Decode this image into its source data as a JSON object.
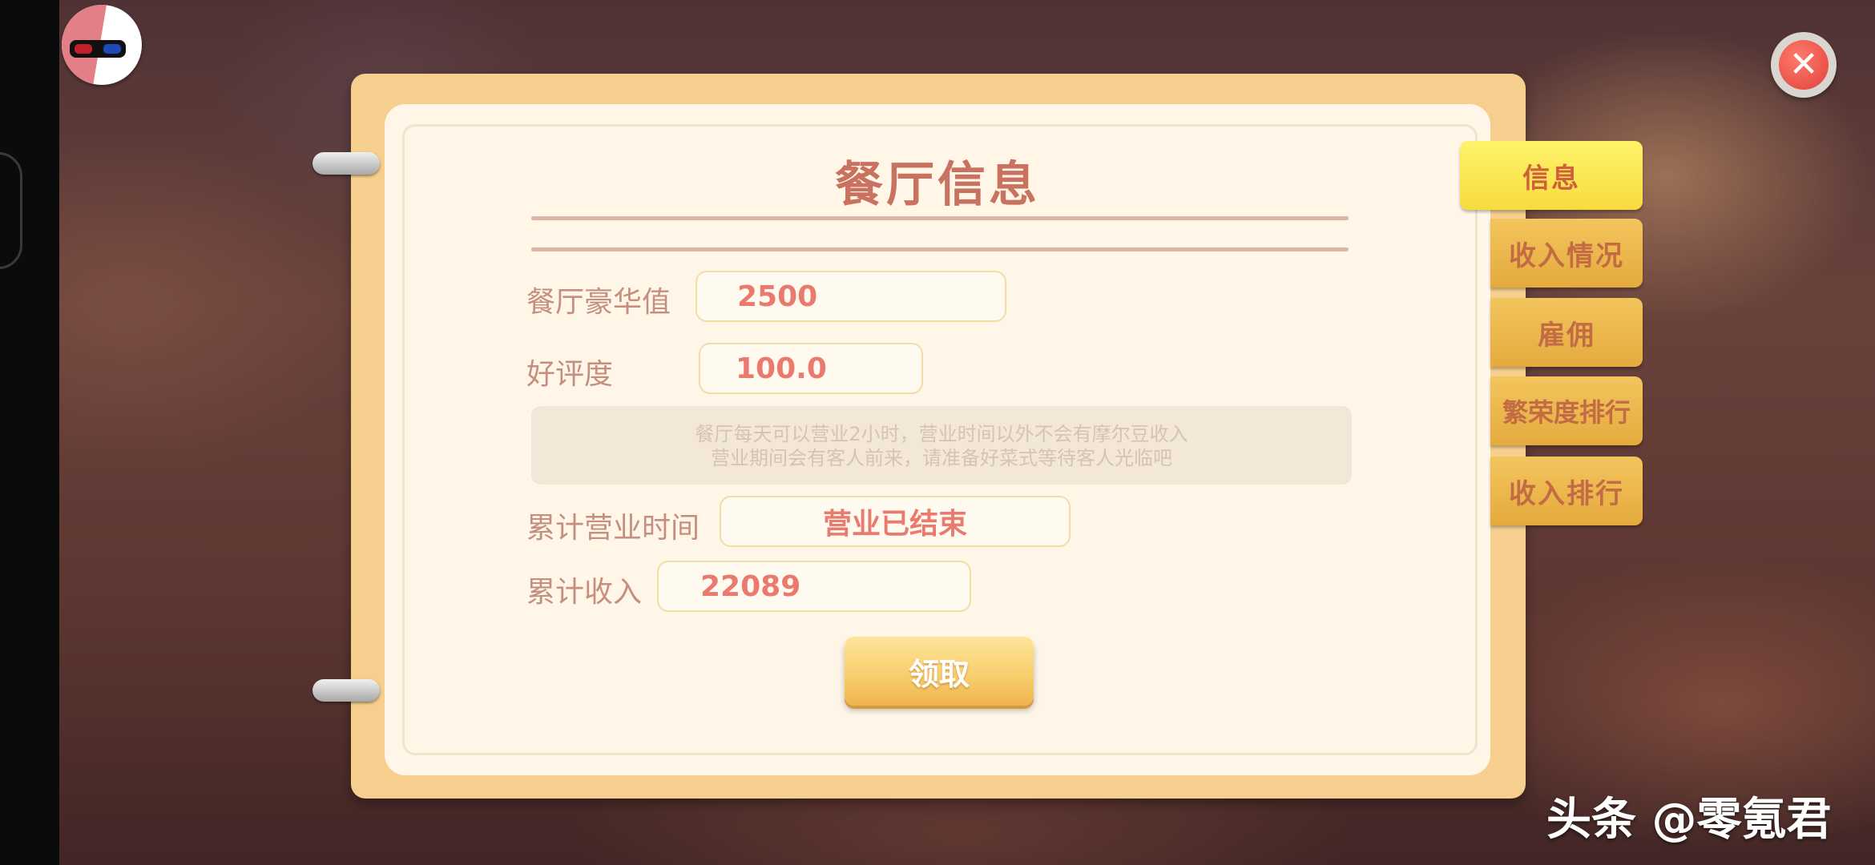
{
  "panel": {
    "title": "餐厅信息",
    "luxury_label": "餐厅豪华值",
    "luxury_value": "2500",
    "rating_label": "好评度",
    "rating_value": "100.0",
    "notice_line1": "餐厅每天可以营业2小时，营业时间以外不会有摩尔豆收入",
    "notice_line2": "营业期间会有客人前来，请准备好菜式等待客人光临吧",
    "hours_label": "累计营业时间",
    "hours_value": "营业已结束",
    "income_label": "累计收入",
    "income_value": "22089",
    "claim_button": "领取"
  },
  "tabs": [
    {
      "label": "信息",
      "active": true
    },
    {
      "label": "收入情况",
      "active": false
    },
    {
      "label": "雇佣",
      "active": false
    },
    {
      "label": "繁荣度排行",
      "active": false
    },
    {
      "label": "收入排行",
      "active": false
    }
  ],
  "close_icon": "close-icon",
  "watermark": "头条 @零氪君",
  "colors": {
    "title": "#c9725f",
    "value_text": "#ea7a6e",
    "active_tab": "#f7dc3f",
    "tab": "#e5aa3e",
    "close": "#e0413b"
  }
}
